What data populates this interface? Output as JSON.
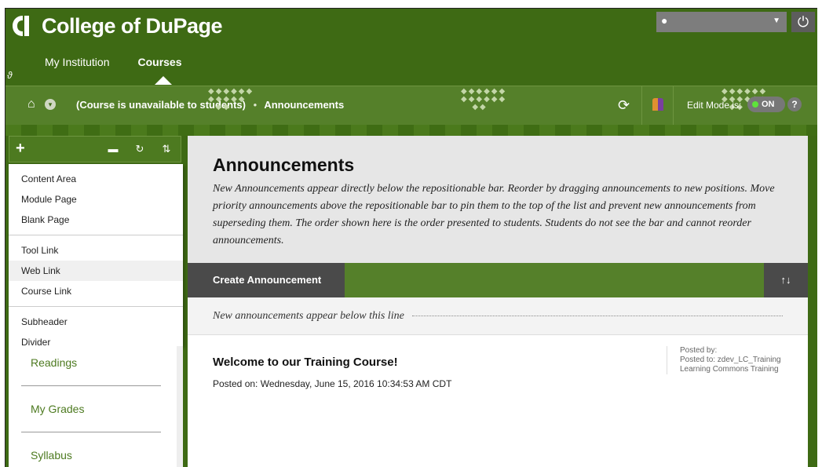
{
  "app": {
    "logo_text": "College of DuPage",
    "nav_tabs": [
      {
        "label": "My Institution"
      },
      {
        "label": "Courses"
      }
    ]
  },
  "breadcrumb": {
    "status": "(Course is unavailable to students)",
    "page": "Announcements"
  },
  "edit_mode": {
    "label": "Edit Mode is:",
    "value": "ON",
    "help": "?"
  },
  "left_menu": {
    "add_label": "+",
    "dropdown_groups": [
      [
        "Content Area",
        "Module Page",
        "Blank Page"
      ],
      [
        "Tool Link",
        "Web Link",
        "Course Link"
      ],
      [
        "Subheader",
        "Divider"
      ]
    ],
    "links": [
      "Readings",
      "My Grades",
      "Syllabus"
    ]
  },
  "main": {
    "title": "Announcements",
    "description": "New Announcements appear directly below the repositionable bar. Reorder by dragging announcements to new positions. Move priority announcements above the repositionable bar to pin them to the top of the list and prevent new announcements from superseding them. The order shown here is the order presented to students. Students do not see the bar and cannot reorder announcements.",
    "create_button": "Create Announcement",
    "sort_label": "↑↓",
    "reposition_text": "New announcements appear below this line",
    "announcement": {
      "title": "Welcome to our Training Course!",
      "posted_on": "Posted on: Wednesday, June 15, 2016 10:34:53 AM CDT",
      "posted_by": "Posted by:",
      "posted_to": "Posted to: zdev_LC_Training",
      "course": "Learning Commons Training"
    }
  },
  "colors": {
    "brand_green": "#3e6a14",
    "bar_green": "#55802a",
    "link_green": "#4d7a20",
    "dark_gray": "#4a4a4a"
  },
  "icons": [
    "logo-mark-icon",
    "link-icon",
    "user-icon",
    "chevron-down-icon",
    "power-icon",
    "home-icon",
    "student-preview-icon",
    "palette-icon",
    "folder-icon",
    "refresh-icon",
    "sort-icon"
  ]
}
